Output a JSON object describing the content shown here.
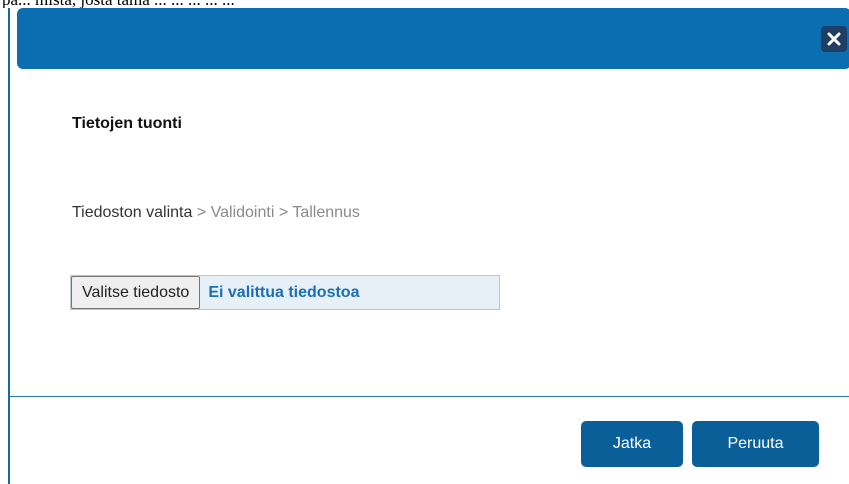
{
  "background_text": "pa... mista, josta tämä ... ... ... ... ...",
  "dialog": {
    "title": "Tietojen tuonti",
    "close_icon": "close-icon",
    "header_color": "#0b6eb0"
  },
  "steps": {
    "current": "Tiedoston valinta",
    "separator": ">",
    "step2": "Validointi",
    "step3": "Tallennus"
  },
  "file_input": {
    "button_label": "Valitse tiedosto",
    "status_text": "Ei valittua tiedostoa"
  },
  "footer": {
    "continue_label": "Jatka",
    "cancel_label": "Peruuta",
    "button_color": "#0b5f99"
  }
}
